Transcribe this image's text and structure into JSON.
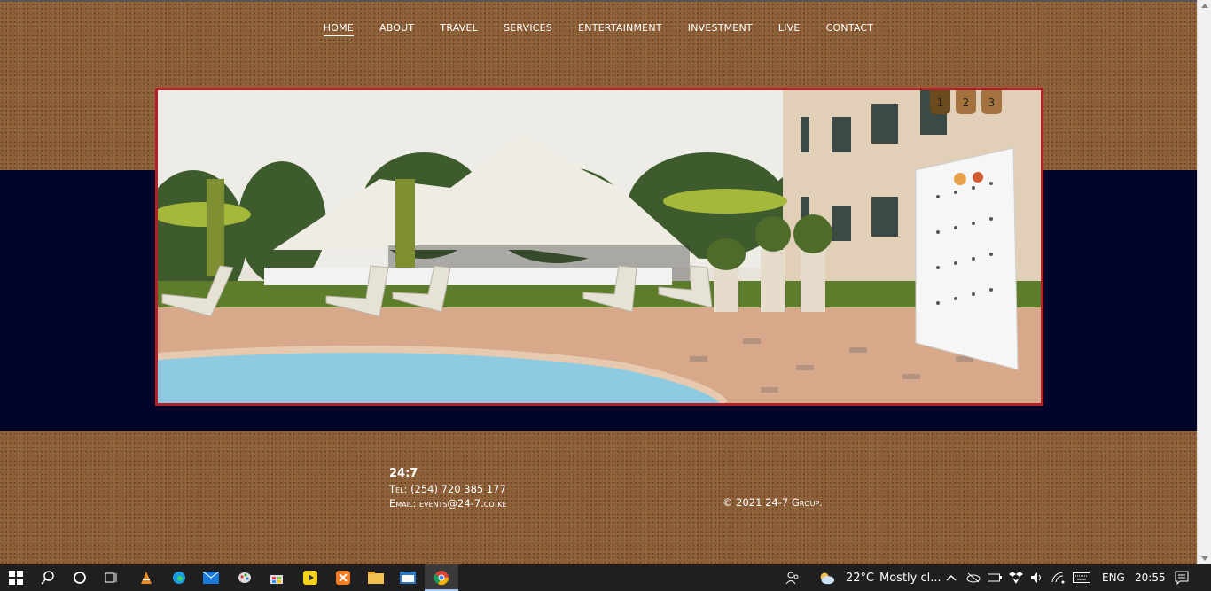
{
  "nav": {
    "items": [
      "HOME",
      "ABOUT",
      "TRAVEL",
      "SERVICES",
      "ENTERTAINMENT",
      "INVESTMENT",
      "LIVE",
      "CONTACT"
    ],
    "active": "HOME"
  },
  "slider": {
    "dots": [
      "1",
      "2",
      "3"
    ],
    "active_dot": "1"
  },
  "footer": {
    "brand": "24:7",
    "tel": "Tel: (254) 720 385 177",
    "email": "Email: events@24-7.co.ke",
    "copyright": "© 2021 24-7 Group."
  },
  "taskbar": {
    "weather_temp": "22°C",
    "weather_text": "Mostly cl...",
    "language": "ENG",
    "time": "20:55"
  },
  "colors": {
    "navy_band": "#000428",
    "slider_border": "#b3202a",
    "dot": "#a4723f",
    "dot_active": "#6b4a1e"
  }
}
